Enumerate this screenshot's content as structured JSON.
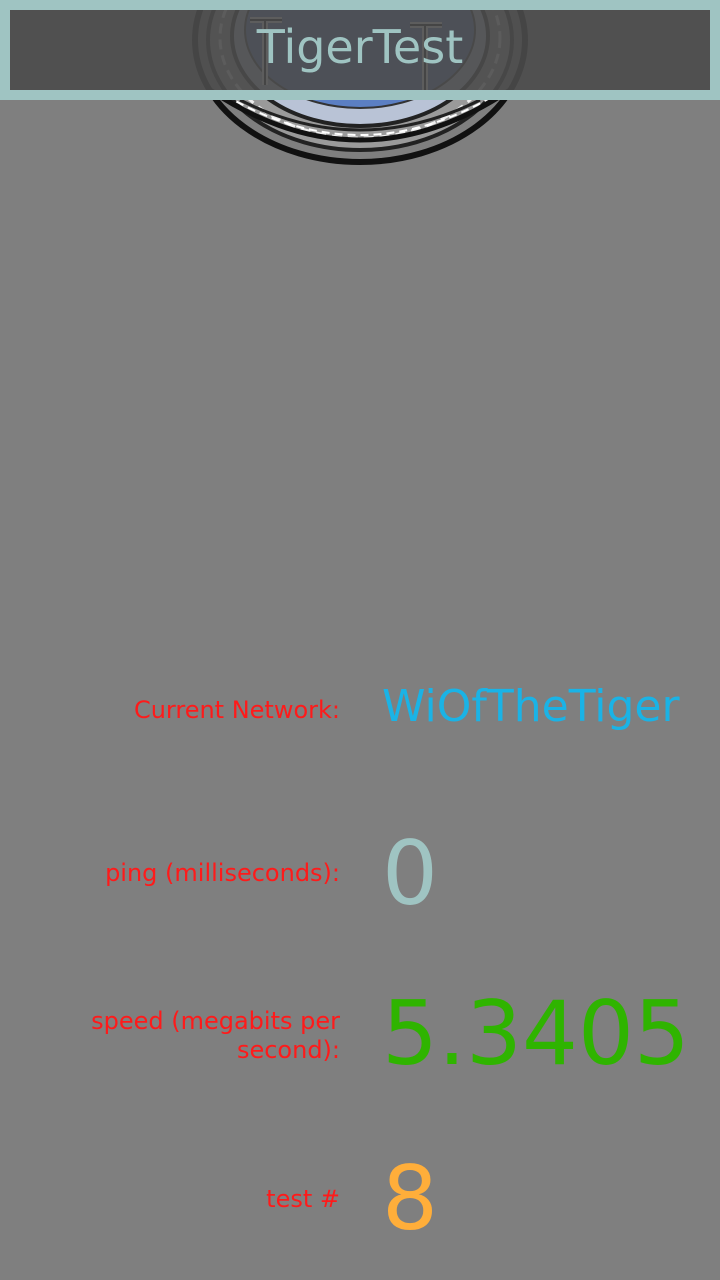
{
  "app": {
    "title": "TigerTest"
  },
  "stats": {
    "network": {
      "label": "Current Network:",
      "value": "WiOfTheTiger"
    },
    "ping": {
      "label": "ping (milliseconds):",
      "value": "0"
    },
    "speed": {
      "label": "speed (megabits per second):",
      "value": "5.3405"
    },
    "test": {
      "label": "test #",
      "value": "8"
    }
  },
  "colors": {
    "background": "#7f7f7f",
    "title_bar": "#4b4b4b",
    "title_accent": "#9fc4c2",
    "label": "#ff1a1a",
    "network_value": "#1ab3e6",
    "ping_value": "#9fc4c2",
    "speed_value": "#2fb400",
    "test_value": "#ffae3a"
  },
  "icons": {
    "logo": "tiger-test-stamp-logo"
  }
}
